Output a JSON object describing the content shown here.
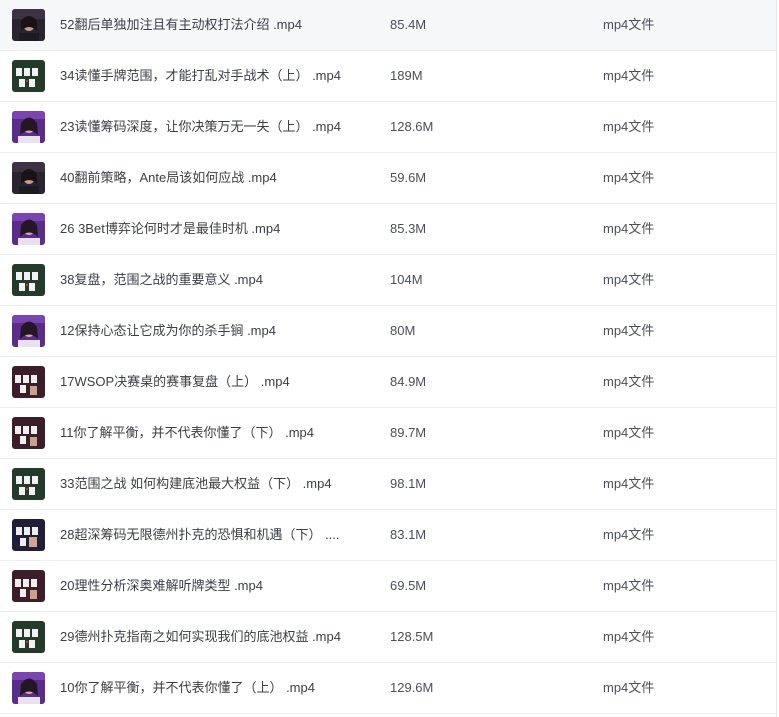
{
  "files": [
    {
      "name": "52翻后单独加注且有主动权打法介绍 .mp4",
      "size": "85.4M",
      "type": "mp4文件",
      "thumb": "portrait-dark-icon"
    },
    {
      "name": "34读懂手牌范围，才能打乱对手战术（上） .mp4",
      "size": "189M",
      "type": "mp4文件",
      "thumb": "cards-green-icon"
    },
    {
      "name": "23读懂筹码深度，让你决策万无一失（上） .mp4",
      "size": "128.6M",
      "type": "mp4文件",
      "thumb": "portrait-purple-icon"
    },
    {
      "name": "40翻前策略，Ante局该如何应战 .mp4",
      "size": "59.6M",
      "type": "mp4文件",
      "thumb": "portrait-dark-icon"
    },
    {
      "name": "26 3Bet博弈论何时才是最佳时机 .mp4",
      "size": "85.3M",
      "type": "mp4文件",
      "thumb": "portrait-purple-icon"
    },
    {
      "name": "38复盘，范围之战的重要意义 .mp4",
      "size": "104M",
      "type": "mp4文件",
      "thumb": "cards-green-icon"
    },
    {
      "name": "12保持心态让它成为你的杀手锏 .mp4",
      "size": "80M",
      "type": "mp4文件",
      "thumb": "portrait-purple-icon"
    },
    {
      "name": "17WSOP决赛桌的赛事复盘（上） .mp4",
      "size": "84.9M",
      "type": "mp4文件",
      "thumb": "cards-maroon-icon"
    },
    {
      "name": "11你了解平衡，并不代表你懂了（下） .mp4",
      "size": "89.7M",
      "type": "mp4文件",
      "thumb": "cards-maroon-icon"
    },
    {
      "name": "33范围之战 如何构建底池最大权益（下） .mp4",
      "size": "98.1M",
      "type": "mp4文件",
      "thumb": "cards-green-icon"
    },
    {
      "name": "28超深筹码无限德州扑克的恐惧和机遇（下） ....",
      "size": "83.1M",
      "type": "mp4文件",
      "thumb": "cards-navy-icon"
    },
    {
      "name": "20理性分析深奥难解听牌类型 .mp4",
      "size": "69.5M",
      "type": "mp4文件",
      "thumb": "cards-maroon-icon"
    },
    {
      "name": "29德州扑克指南之如何实现我们的底池权益 .mp4",
      "size": "128.5M",
      "type": "mp4文件",
      "thumb": "cards-green-icon"
    },
    {
      "name": "10你了解平衡，并不代表你懂了（上） .mp4",
      "size": "129.6M",
      "type": "mp4文件",
      "thumb": "portrait-purple-icon"
    }
  ]
}
